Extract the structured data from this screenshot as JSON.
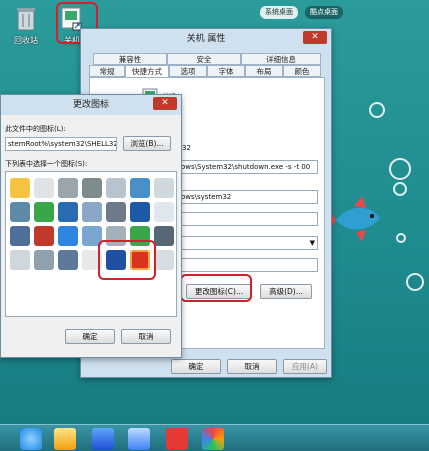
{
  "desktop": {
    "icons": [
      {
        "label": "回收站"
      },
      {
        "label": "关机"
      }
    ],
    "top_buttons": [
      "系统桌面",
      "酷点桌面"
    ]
  },
  "properties_dialog": {
    "title": "关机 属性",
    "tabs_row1": [
      "兼容性",
      "安全",
      "详细信息"
    ],
    "tabs_row2": [
      "常规",
      "快捷方式",
      "选项",
      "字体",
      "布局",
      "颜色"
    ],
    "selected_tab": "快捷方式",
    "name_fragment": "关机",
    "fragment_2": "32",
    "target_value": "ows\\System32\\shutdown.exe -s -t 00",
    "start_in_value": "ows\\system32",
    "change_icon_button": "更改图标(C)...",
    "advanced_button": "高级(D)...",
    "ok_button": "确定",
    "cancel_button": "取消",
    "apply_button": "应用(A)"
  },
  "change_icon_dialog": {
    "title": "更改图标",
    "file_label": "此文件中的图标(L):",
    "file_value": "stemRoot%\\system32\\SHELL32.",
    "browse_button": "浏览(B)...",
    "list_label": "下列表中选择一个图标(S):",
    "ok_button": "确定",
    "cancel_button": "取消"
  },
  "colors": {
    "accent_red": "#d0222a",
    "desktop_teal": "#1e8b8f"
  }
}
